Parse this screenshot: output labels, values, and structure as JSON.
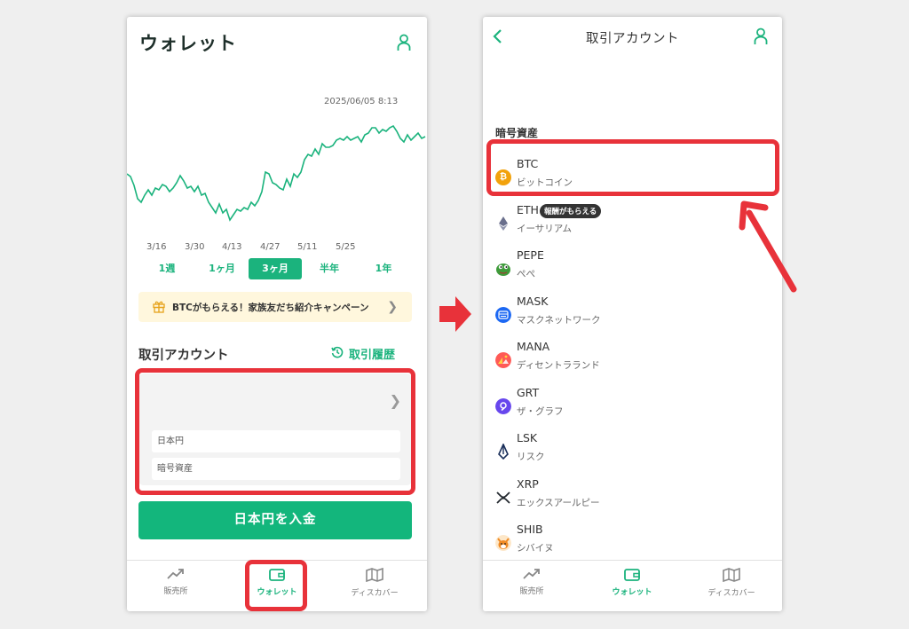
{
  "left": {
    "title": "ウォレット",
    "chart_data": {
      "type": "line",
      "timestamp": "2025/06/05 8:13",
      "x_ticks": [
        "3/16",
        "3/30",
        "4/13",
        "4/27",
        "5/11",
        "5/25"
      ],
      "series_color": "#1bb37d"
    },
    "range_tabs": [
      {
        "label": "1週",
        "active": false
      },
      {
        "label": "1ヶ月",
        "active": false
      },
      {
        "label": "3ヶ月",
        "active": true
      },
      {
        "label": "半年",
        "active": false
      },
      {
        "label": "1年",
        "active": false
      }
    ],
    "campaign": "BTCがもらえる！家族友だち紹介キャンペーン",
    "section_title": "取引アカウント",
    "history_label": "取引履歴",
    "account_rows": [
      "日本円",
      "暗号資産"
    ],
    "deposit_label": "日本円を入金",
    "nav": [
      {
        "label": "販売所",
        "icon": "chart-trend-icon",
        "active": false
      },
      {
        "label": "ウォレット",
        "icon": "wallet-icon",
        "active": true
      },
      {
        "label": "ディスカバー",
        "icon": "map-icon",
        "active": false
      }
    ]
  },
  "right": {
    "title": "取引アカウント",
    "asset_header": "暗号資産",
    "assets": [
      {
        "symbol": "BTC",
        "name": "ビットコイン",
        "color": "#f2a20c",
        "badge": ""
      },
      {
        "symbol": "ETH",
        "name": "イーサリアム",
        "color": "#6a6f8c",
        "badge": "報酬がもらえる"
      },
      {
        "symbol": "PEPE",
        "name": "ぺぺ",
        "color": "#3e9b3a",
        "badge": ""
      },
      {
        "symbol": "MASK",
        "name": "マスクネットワーク",
        "color": "#1c68f3",
        "badge": ""
      },
      {
        "symbol": "MANA",
        "name": "ディセントラランド",
        "color": "#ff5a56",
        "badge": ""
      },
      {
        "symbol": "GRT",
        "name": "ザ・グラフ",
        "color": "#6747ed",
        "badge": ""
      },
      {
        "symbol": "LSK",
        "name": "リスク",
        "color": "#1a2f5a",
        "badge": ""
      },
      {
        "symbol": "XRP",
        "name": "エックスアールピー",
        "color": "#23292f",
        "badge": ""
      },
      {
        "symbol": "SHIB",
        "name": "シバイヌ",
        "color": "#f08a24",
        "badge": ""
      }
    ],
    "nav": [
      {
        "label": "販売所",
        "icon": "chart-trend-icon",
        "active": false
      },
      {
        "label": "ウォレット",
        "icon": "wallet-icon",
        "active": true
      },
      {
        "label": "ディスカバー",
        "icon": "map-icon",
        "active": false
      }
    ]
  },
  "colors": {
    "accent": "#1bb37d",
    "highlight": "#e8323a",
    "campaign_bg": "#fff7dd"
  }
}
